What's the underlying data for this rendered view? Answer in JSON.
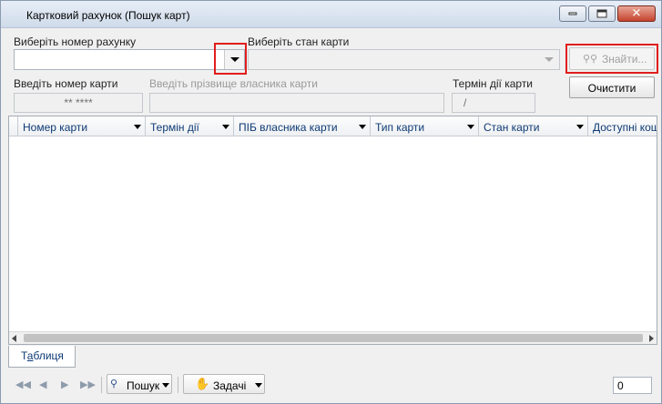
{
  "window": {
    "title": "Картковий рахунок (Пошук карт)",
    "controls": {
      "minimize": "minimize-icon",
      "maximize": "maximize-icon",
      "close": "close-icon"
    }
  },
  "filters": {
    "account_label": "Виберіть номер рахунку",
    "account_value": "",
    "card_state_label": "Виберіть стан карти",
    "card_state_value": "",
    "card_number_label": "Введіть номер карти",
    "card_number_value": "** ****",
    "owner_label": "Введіть прізвище власника карти",
    "owner_value": "",
    "expiry_label": "Термін дії карти",
    "expiry_value": "/",
    "find_button": "Знайти...",
    "clear_button": "Очистити"
  },
  "grid": {
    "columns": [
      "Номер карти",
      "Термін дії",
      "ПІБ власника карти",
      "Тип карти",
      "Стан карти",
      "Доступні кош"
    ],
    "rows": []
  },
  "tabs": [
    {
      "label_prefix": "Т",
      "label_underlined": "а",
      "label_rest": "блиця"
    }
  ],
  "toolbar": {
    "nav": [
      "first-icon",
      "prev-icon",
      "next-icon",
      "last-icon"
    ],
    "search_label": "Пошук",
    "tasks_label": "Задачі",
    "record_count": "0"
  },
  "colors": {
    "highlight": "#e11d1d",
    "header_text": "#0e3a74"
  }
}
